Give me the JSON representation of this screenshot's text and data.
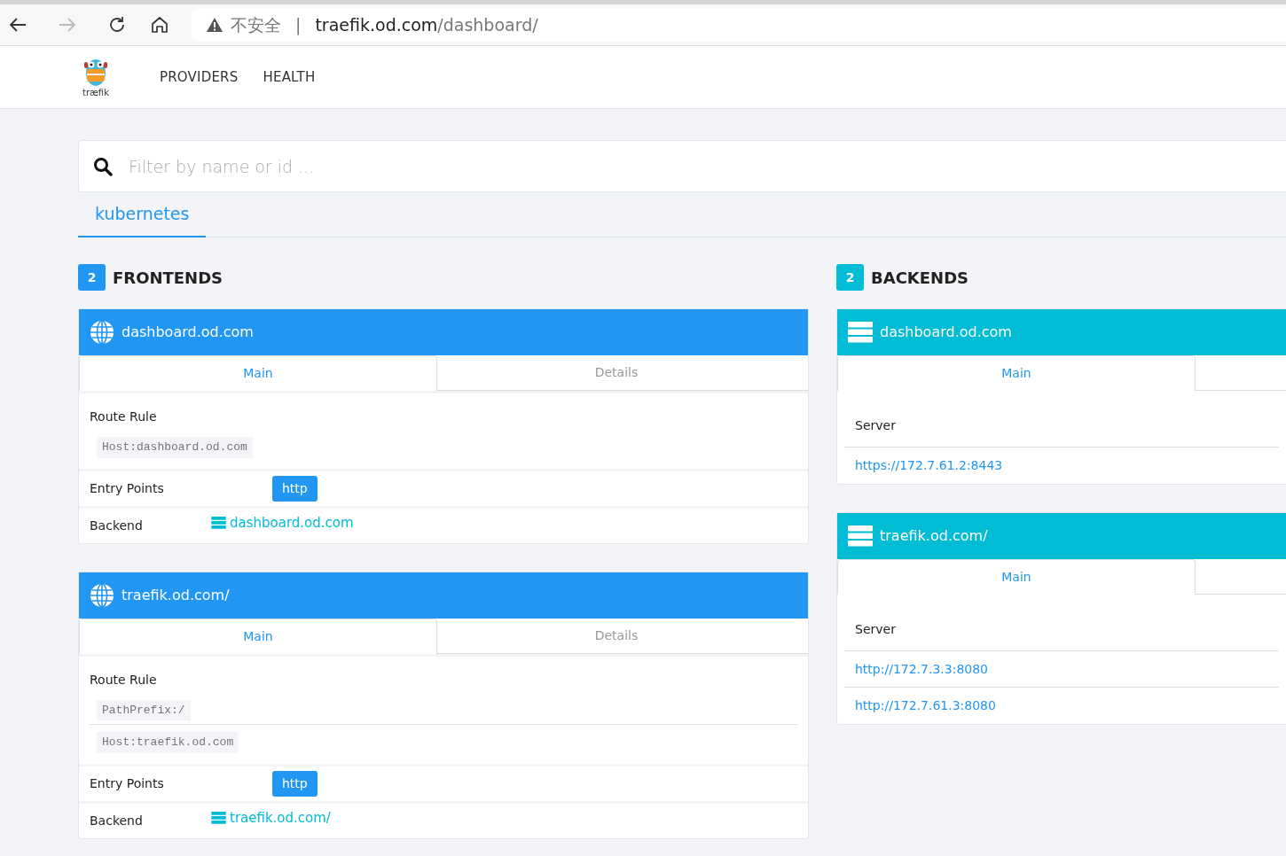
{
  "browser": {
    "back_enabled": true,
    "forward_enabled": false,
    "security_label": "不安全",
    "separator": "|",
    "url_host": "traefik.od.com",
    "url_path": "/dashboard/"
  },
  "navbar": {
    "logo_text": "træfik",
    "items": [
      {
        "label": "PROVIDERS"
      },
      {
        "label": "HEALTH"
      }
    ]
  },
  "search": {
    "placeholder": "Filter by name or id ..."
  },
  "provider_tabs": [
    {
      "label": "kubernetes",
      "selected": true
    }
  ],
  "frontends": {
    "count": "2",
    "title": "FRONTENDS",
    "items": [
      {
        "name": "dashboard.od.com",
        "tabs": [
          {
            "label": "Main",
            "selected": true
          },
          {
            "label": "Details",
            "selected": false
          }
        ],
        "route_rule_label": "Route Rule",
        "rules": [
          "Host:dashboard.od.com"
        ],
        "entry_points_label": "Entry Points",
        "entry_points": [
          "http"
        ],
        "backend_label": "Backend",
        "backend": "dashboard.od.com"
      },
      {
        "name": "traefik.od.com/",
        "tabs": [
          {
            "label": "Main",
            "selected": true
          },
          {
            "label": "Details",
            "selected": false
          }
        ],
        "route_rule_label": "Route Rule",
        "rules": [
          "PathPrefix:/",
          "Host:traefik.od.com"
        ],
        "entry_points_label": "Entry Points",
        "entry_points": [
          "http"
        ],
        "backend_label": "Backend",
        "backend": "traefik.od.com/"
      }
    ]
  },
  "backends": {
    "count": "2",
    "title": "BACKENDS",
    "items": [
      {
        "name": "dashboard.od.com",
        "tabs": [
          {
            "label": "Main",
            "selected": true
          }
        ],
        "server_label": "Server",
        "servers": [
          "https://172.7.61.2:8443"
        ]
      },
      {
        "name": "traefik.od.com/",
        "tabs": [
          {
            "label": "Main",
            "selected": true
          }
        ],
        "server_label": "Server",
        "servers": [
          "http://172.7.3.3:8080",
          "http://172.7.61.3:8080"
        ]
      }
    ]
  }
}
